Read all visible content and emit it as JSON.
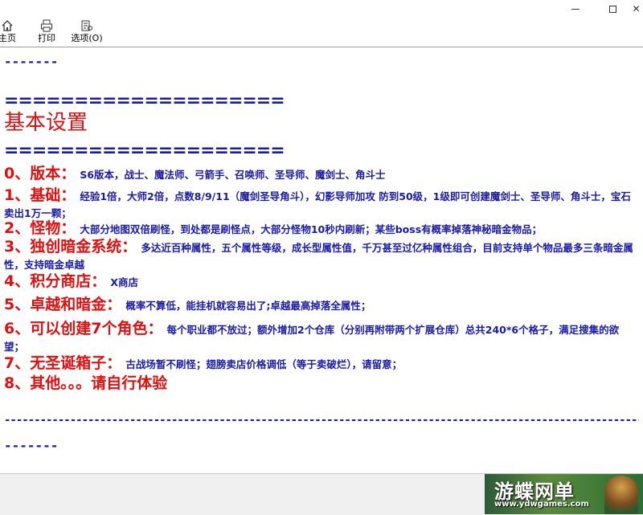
{
  "toolbar": {
    "home_label": "主页",
    "print_label": "打印",
    "options_label": "选项(O)"
  },
  "content": {
    "dash_top": "-------",
    "eq_line": "====================",
    "heading": "基本设置",
    "items": [
      {
        "key": "0、版本：",
        "value": "S6版本，战士、魔法师、弓箭手、召唤师、圣导师、魔剑士、角斗士"
      },
      {
        "key": "1、基础：",
        "value": "经验1倍，大师2倍，点数8/9/11（魔剑圣导角斗），幻影导师加攻   防到50级，1级即可创建魔剑士、圣导师、角斗士，宝石卖出1万一颗；"
      },
      {
        "key": "2、怪物：",
        "value": "大部分地图双倍刷怪，到处都是刷怪点，大部分怪物10秒内刷新；某些boss有概率掉落神秘暗金物品；"
      },
      {
        "key": "3、独创暗金系统：",
        "value": "多达近百种属性，五个属性等级，成长型属性值，千万甚至过亿种属性组合，目前支持单个物品最多三条暗金属性，支持暗金卓越"
      },
      {
        "key": "4、积分商店：",
        "value": "X商店"
      },
      {
        "key": "5、卓越和暗金：",
        "value": "概率不算低，能挂机就容易出了;卓越最高掉落全属性；"
      },
      {
        "key": "6、可以创建7个角色：",
        "value": "每个职业都不放过；额外增加2个仓库（分别再附带两个扩展仓库）总共240*6个格子，满足搜集的欲望；"
      },
      {
        "key": "7、无圣诞箱子：",
        "value": "古战场暂不刷怪；翅膀卖店价格调低（等于卖破烂），请留意；"
      },
      {
        "key": "8、其他。。。请自行体验",
        "value": ""
      }
    ],
    "long_dash": "---------------------------------------------------------------------------------------------------------------------------",
    "dash_bottom": "-------"
  },
  "watermark": {
    "title": "游蝶网单",
    "url": "www.ydwgames.com"
  },
  "colors": {
    "key_red": "#e01010",
    "value_blue": "#1a1aa8"
  }
}
